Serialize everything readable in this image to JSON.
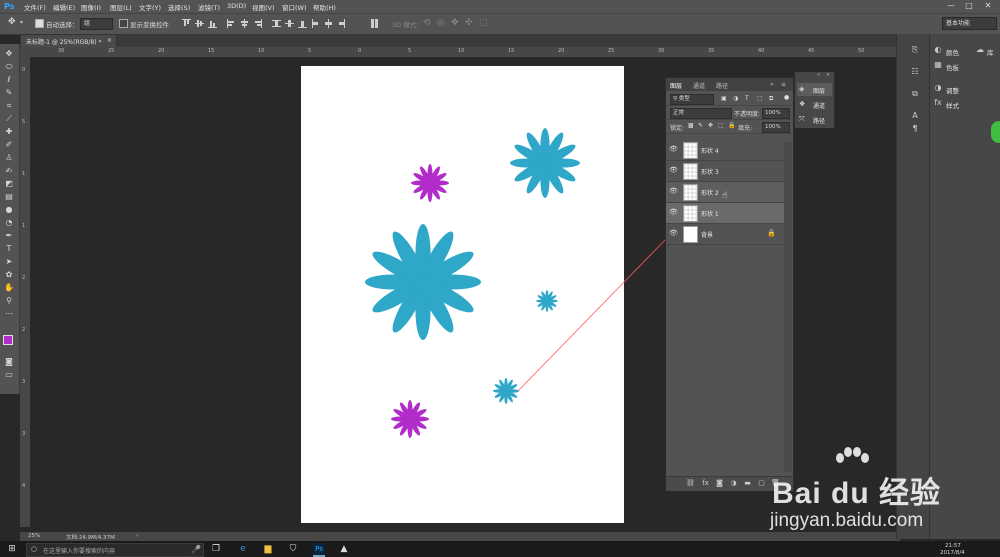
{
  "app": {
    "logo": "Ps"
  },
  "menu": {
    "items": [
      "文件(F)",
      "编辑(E)",
      "图像(I)",
      "图层(L)",
      "文字(Y)",
      "选择(S)",
      "滤镜(T)",
      "3D(D)",
      "视图(V)",
      "窗口(W)",
      "帮助(H)"
    ]
  },
  "window_controls": {
    "minimize": "—",
    "maximize": "□",
    "close": "✕"
  },
  "options_bar": {
    "auto_select_label": "自动选择：",
    "auto_select_value": "组",
    "show_transform_label": "显示变换控件",
    "mode_3d_label": "3D 模式：",
    "workspace": "基本功能"
  },
  "document": {
    "tab_title": "未标题-1 @ 25%(RGB/8) *",
    "tab_close": "×"
  },
  "status": {
    "zoom": "25%",
    "doc_info": "文档:24.9M/4.37M"
  },
  "ruler_top_labels": [
    "30",
    "25",
    "20",
    "15",
    "10",
    "5",
    "0",
    "5",
    "10",
    "15",
    "20",
    "25",
    "30",
    "35",
    "40",
    "45",
    "50"
  ],
  "ruler_left_labels": [
    "0",
    "5",
    "1",
    "1",
    "2",
    "2",
    "3",
    "3",
    "4"
  ],
  "right_dock": {
    "items": [
      {
        "label": "颜色",
        "icon": "color-palette-icon"
      },
      {
        "label": "色板",
        "icon": "swatches-icon"
      },
      {
        "label": "调整",
        "icon": "adjustments-icon"
      },
      {
        "label": "样式",
        "icon": "styles-icon"
      }
    ],
    "library": "库"
  },
  "layers_panel": {
    "tabs": [
      "图层",
      "通道",
      "路径"
    ],
    "kind_label": "类型",
    "blend_mode": "正常",
    "opacity_label": "不透明度:",
    "opacity_value": "100%",
    "lock_label": "锁定:",
    "fill_label": "填充:",
    "fill_value": "100%",
    "layers": [
      {
        "name": "形状 4",
        "state": "normal"
      },
      {
        "name": "形状 3",
        "state": "normal"
      },
      {
        "name": "形状 2",
        "state": "hilite"
      },
      {
        "name": "形状 1",
        "state": "selected"
      },
      {
        "name": "背景",
        "state": "background"
      }
    ],
    "footer_icons": [
      "link-icon",
      "fx-icon",
      "mask-icon",
      "adjustment-layer-icon",
      "group-folder-icon",
      "new-layer-icon",
      "trash-icon"
    ]
  },
  "sub_panel": {
    "items": [
      "图层",
      "通道",
      "路径"
    ]
  },
  "canvas": {
    "background_color": "#ffffff",
    "blue_color": "#2ea7c9",
    "purple_color": "#b12cc8"
  },
  "taskbar": {
    "search_placeholder": "在这里输入你要搜索的内容",
    "time": "21:57",
    "date": "2017/8/4"
  },
  "watermark": {
    "brand": "Bai du 经验",
    "url": "jingyan.baidu.com"
  }
}
